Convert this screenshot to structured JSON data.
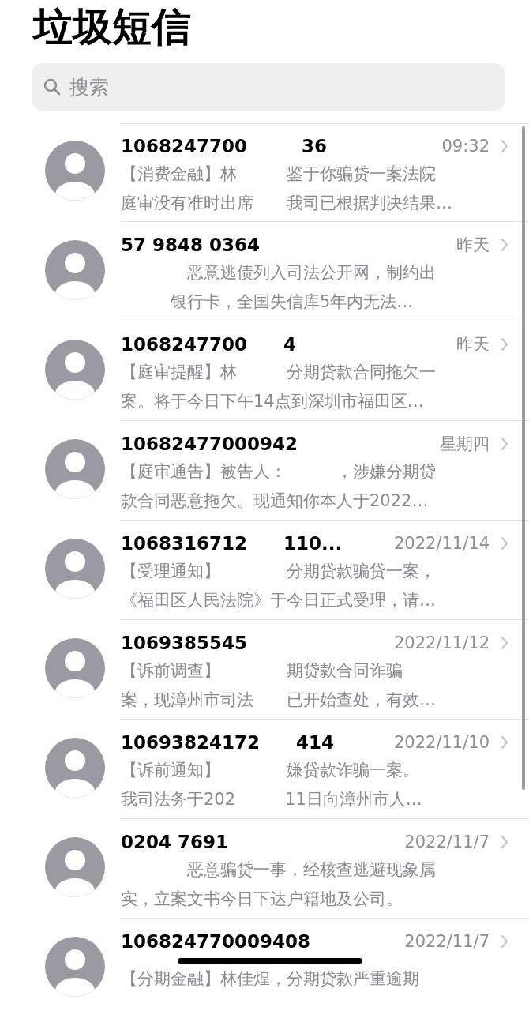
{
  "title": "垃圾短信",
  "search": {
    "placeholder": "搜索"
  },
  "messages": [
    {
      "sender": "1068247700　　　36",
      "time": "09:32",
      "preview": [
        "【消费金融】林　　　鉴于你骗贷一案法院",
        "庭审没有准时出席　　我司已根据判决结果…"
      ]
    },
    {
      "sender": "57 9848 0364",
      "time": "昨天",
      "preview": [
        "　　　　恶意逃债列入司法公开网，制约出",
        "　　　银行卡，全国失信库5年内无法…"
      ]
    },
    {
      "sender": "1068247700　　4",
      "time": "昨天",
      "preview": [
        "【庭审提醒】林　　　分期贷款合同拖欠一",
        "案。将于今日下午14点到深圳市福田区…"
      ]
    },
    {
      "sender": "10682477000942",
      "time": "星期四",
      "preview": [
        "【庭审通告】被告人：　　　，涉嫌分期贷",
        "款合同恶意拖欠。现通知你本人于2022…"
      ]
    },
    {
      "sender": "1068316712　　110...",
      "time": "2022/11/14",
      "preview": [
        "【受理通知】　　　　分期贷款骗贷一案，",
        "《福田区人民法院》于今日正式受理，请…"
      ]
    },
    {
      "sender": "1069385545",
      "time": "2022/11/12",
      "preview": [
        "【诉前调查】　　　　期贷款合同诈骗",
        "案，现漳州市司法　　已开始查处，有效…"
      ]
    },
    {
      "sender": "10693824172　　414",
      "time": "2022/11/10",
      "preview": [
        "【诉前通知】　　　　嫌贷款诈骗一案。",
        "我司法务于202　　　11日向漳州市人…"
      ]
    },
    {
      "sender": "0204 7691",
      "time": "2022/11/7",
      "preview": [
        "　　　　恶意骗贷一事，经核查逃避现象属",
        "实，立案文书今日下达户籍地及公司。"
      ]
    },
    {
      "sender": "106824770009408",
      "time": "2022/11/7",
      "preview": [
        "【分期金融】林佳煌，分期贷款严重逾期"
      ]
    }
  ]
}
